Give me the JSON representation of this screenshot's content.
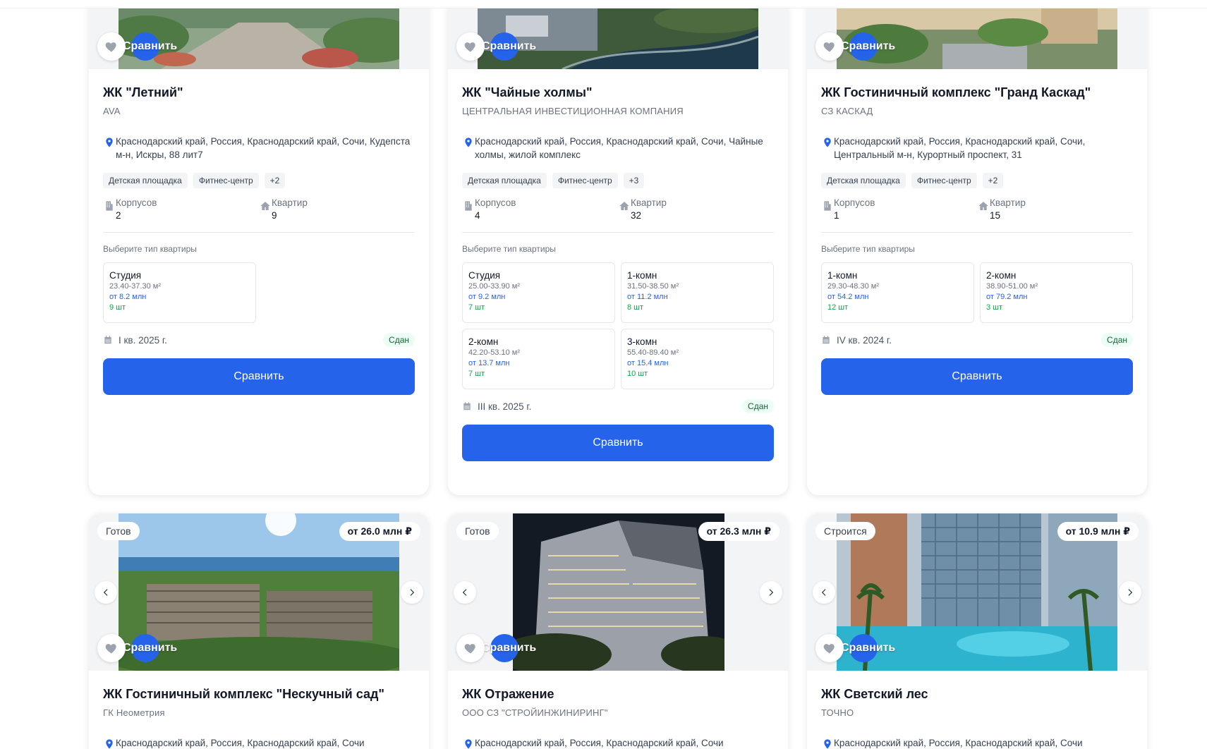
{
  "compare_label": "Сравнить",
  "choose_type_label": "Выберите тип квартиры",
  "stat_labels": {
    "buildings": "Корпусов",
    "apartments": "Квартир"
  },
  "colors": {
    "accent": "#2563eb",
    "price": "#2563eb",
    "count": "#16a34a"
  },
  "cards": [
    {
      "title": "ЖК \"Летний\"",
      "developer": "AVA",
      "address": "Краснодарский край, Россия, Краснодарский край, Сочи, Кудепста м-н, Искры, 88 лит7",
      "features": [
        "Детская площадка",
        "Фитнес-центр",
        "+2"
      ],
      "buildings": "2",
      "apartments": "9",
      "types": [
        {
          "name": "Студия",
          "area": "23.40-37.30 м²",
          "price": "от 8.2 млн",
          "count": "9 шт"
        }
      ],
      "deadline": "I кв. 2025 г.",
      "status": "Сдан"
    },
    {
      "title": "ЖК \"Чайные холмы\"",
      "developer": "ЦЕНТРАЛЬНАЯ ИНВЕСТИЦИОННАЯ КОМПАНИЯ",
      "address": "Краснодарский край, Россия, Краснодарский край, Сочи, Чайные холмы, жилой комплекс",
      "features": [
        "Детская площадка",
        "Фитнес-центр",
        "+3"
      ],
      "buildings": "4",
      "apartments": "32",
      "types": [
        {
          "name": "Студия",
          "area": "25.00-33.90 м²",
          "price": "от 9.2 млн",
          "count": "7 шт"
        },
        {
          "name": "1-комн",
          "area": "31.50-38.50 м²",
          "price": "от 11.2 млн",
          "count": "8 шт"
        },
        {
          "name": "2-комн",
          "area": "42.20-53.10 м²",
          "price": "от 13.7 млн",
          "count": "7 шт"
        },
        {
          "name": "3-комн",
          "area": "55.40-89.40 м²",
          "price": "от 15.4 млн",
          "count": "10 шт"
        }
      ],
      "deadline": "III кв. 2025 г.",
      "status": "Сдан"
    },
    {
      "title": "ЖК Гостиничный комплекс \"Гранд Каскад\"",
      "developer": "СЗ КАСКАД",
      "address": "Краснодарский край, Россия, Краснодарский край, Сочи, Центральный м-н, Курортный проспект, 31",
      "features": [
        "Детская площадка",
        "Фитнес-центр",
        "+2"
      ],
      "buildings": "1",
      "apartments": "15",
      "types": [
        {
          "name": "1-комн",
          "area": "29.30-48.30 м²",
          "price": "от 54.2 млн",
          "count": "12 шт"
        },
        {
          "name": "2-комн",
          "area": "38.90-51.00 м²",
          "price": "от 79.2 млн",
          "count": "3 шт"
        }
      ],
      "deadline": "IV кв. 2024 г.",
      "status": "Сдан"
    },
    {
      "title": "ЖК Гостиничный комплекс \"Нескучный сад\"",
      "developer": "ГК Неометрия",
      "ready_status": "Готов",
      "price_badge": "от 26.0 млн ₽",
      "address": "Краснодарский край, Россия, Краснодарский край, Сочи"
    },
    {
      "title": "ЖК Отражение",
      "developer": "ООО СЗ \"СТРОЙИНЖИНИРИНГ\"",
      "ready_status": "Готов",
      "price_badge": "от 26.3 млн ₽",
      "address": "Краснодарский край, Россия, Краснодарский край, Сочи"
    },
    {
      "title": "ЖК Светский лес",
      "developer": "ТОЧНО",
      "ready_status": "Строится",
      "price_badge": "от 10.9 млн ₽",
      "address": "Краснодарский край, Россия, Краснодарский край, Сочи"
    }
  ]
}
